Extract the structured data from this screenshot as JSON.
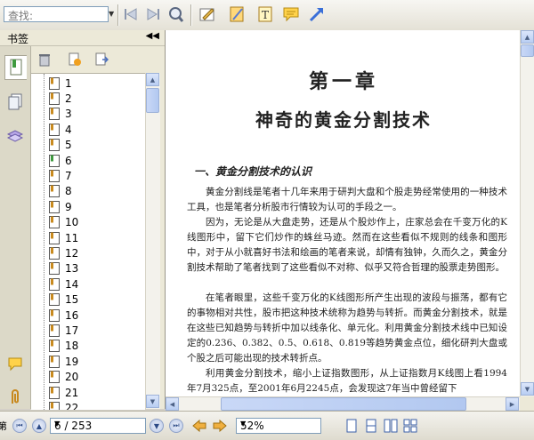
{
  "toolbar": {
    "search_placeholder": "查找:",
    "icons": [
      "prev-result-icon",
      "next-result-icon",
      "search-glass-icon",
      "highlight-tool-icon",
      "note-pad-icon",
      "text-box-icon",
      "comment-icon",
      "arrow-tool-icon"
    ]
  },
  "bookmark_pane": {
    "title": "书签",
    "items": [
      "1",
      "2",
      "3",
      "4",
      "5",
      "6",
      "7",
      "8",
      "9",
      "10",
      "11",
      "12",
      "13",
      "14",
      "15",
      "16",
      "17",
      "18",
      "19",
      "20",
      "21",
      "22"
    ]
  },
  "document": {
    "chapter_number": "第一章",
    "chapter_title": "神奇的黄金分割技术",
    "section_heading": "一、黄金分割技术的认识",
    "paragraphs": [
      "黄金分割线是笔者十几年来用于研判大盘和个股走势经常使用的一种技术工具，也是笔者分析股市行情较为认可的手段之一。",
      "因为，无论是从大盘走势，还是从个股炒作上，庄家总会在千变万化的K线图形中，留下它们炒作的蛛丝马迹。然而在这些看似不规则的线条和图形中，对于从小就喜好书法和绘画的笔者来说，却情有独钟，久而久之，黄金分割技术帮助了笔者找到了这些看似不对称、似乎又符合哲理的股票走势图形。",
      "在笔者眼里，这些千变万化的K线图形所产生出现的波段与振荡，都有它的事物相对共性，股市把这种技术统称为趋势与转折。而黄金分割技术，就是在这些已知趋势与转折中加以线条化、单元化。利用黄金分割技术线中已知设定的0.236、0.382、0.5、0.618、0.819等趋势黄金点位，细化研判大盘或个股之后可能出现的技术转折点。",
      "利用黄金分割技术，缩小上证指数图形，从上证指数月K线图上看1994年7月325点，至2001年6月2245点，会发现这7年当中曾经留下"
    ]
  },
  "navigation": {
    "edge_label": "第",
    "current_page": "6 / 253",
    "zoom": "52%"
  },
  "colors": {
    "chrome": "#ece9d8",
    "scrollbar_accent": "#b8cdf2",
    "nav_button": "#2c4a86"
  }
}
